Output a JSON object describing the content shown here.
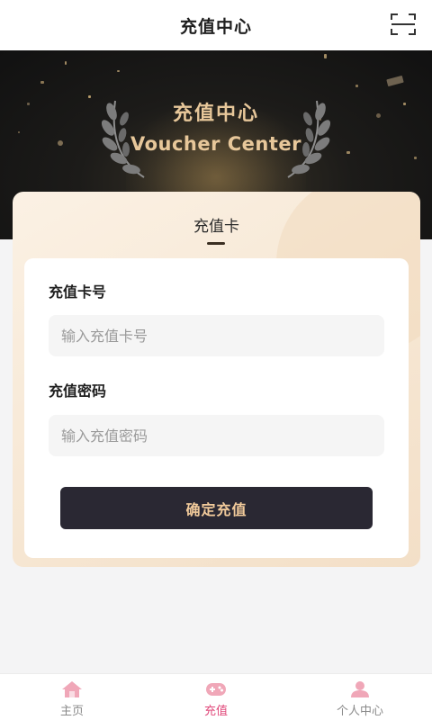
{
  "header": {
    "title": "充值中心",
    "scan_icon": "scan-icon"
  },
  "hero": {
    "title_cn": "充值中心",
    "title_en": "Voucher Center",
    "accent_color": "#e7c79a"
  },
  "panel": {
    "tab_label": "充值卡",
    "card_number": {
      "label": "充值卡号",
      "value": "",
      "placeholder": "输入充值卡号"
    },
    "password": {
      "label": "充值密码",
      "value": "",
      "placeholder": "输入充值密码"
    },
    "submit_label": "确定充值",
    "button_color": "#2a2833"
  },
  "tabbar": {
    "items": [
      {
        "label": "主页",
        "icon": "home-icon",
        "active": false
      },
      {
        "label": "充值",
        "icon": "gamepad-icon",
        "active": true
      },
      {
        "label": "个人中心",
        "icon": "user-icon",
        "active": false
      }
    ],
    "active_color": "#e0487a",
    "inactive_icon_color": "#f0a7b8"
  }
}
